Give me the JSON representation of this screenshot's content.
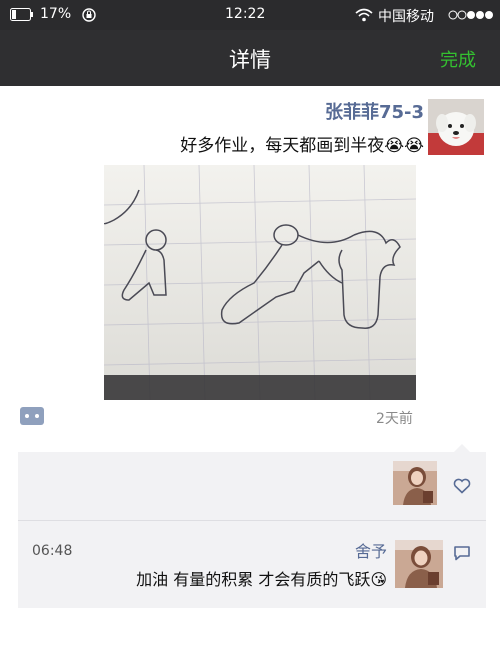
{
  "status_bar": {
    "battery": "17%",
    "time": "12:22",
    "carrier": "中国移动"
  },
  "nav": {
    "title": "详情",
    "done_label": "完成"
  },
  "post": {
    "author": "张菲菲75-3",
    "text": "好多作业，每天都画到半夜😭😭",
    "time_ago": "2天前"
  },
  "feedback": {
    "comment": {
      "name": "舍予",
      "time": "06:48",
      "text": "加油 有量的积累 才会有质的飞跃😘"
    }
  },
  "icons": {
    "wifi": "wifi-icon",
    "battery": "battery-icon",
    "lock": "rotation-lock-icon",
    "like": "heart-icon",
    "comment": "comment-icon",
    "more": "more-dots-icon"
  },
  "colors": {
    "link_blue": "#576b95",
    "done_green": "#34c030",
    "nav_bg": "#2f2f31"
  }
}
